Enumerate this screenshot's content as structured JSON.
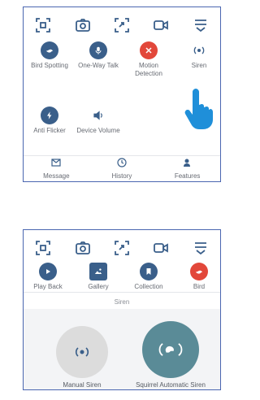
{
  "colors": {
    "icon": "#3a5f8a",
    "border": "#4a66b0",
    "red": "#e2473a",
    "teal": "#5a8b97",
    "gray": "#dcdcdc"
  },
  "toolbar_icons": [
    "fullscreen-icon",
    "camera-icon",
    "crop-icon",
    "video-icon",
    "menu-icon"
  ],
  "panel1": {
    "features": [
      {
        "label": "Bird Spotting",
        "icon": "bird-icon"
      },
      {
        "label": "One-Way Talk",
        "icon": "microphone-icon"
      },
      {
        "label": "Motion Detection",
        "icon": "motion-icon"
      },
      {
        "label": "Siren",
        "icon": "siren-icon"
      },
      {
        "label": "Anti Flicker",
        "icon": "flash-icon"
      },
      {
        "label": "Device Volume",
        "icon": "volume-icon"
      }
    ],
    "nav": [
      {
        "label": "Message",
        "icon": "mail-icon"
      },
      {
        "label": "History",
        "icon": "clock-icon"
      },
      {
        "label": "Features",
        "icon": "person-icon"
      }
    ]
  },
  "panel2": {
    "features": [
      {
        "label": "Play Back",
        "icon": "play-icon"
      },
      {
        "label": "Gallery",
        "icon": "image-icon"
      },
      {
        "label": "Collection",
        "icon": "bookmark-icon"
      },
      {
        "label": "Bird",
        "icon": "bird-icon"
      }
    ],
    "section_title": "Siren",
    "manual_siren": {
      "label": "Manual Siren"
    },
    "auto_siren": {
      "label": "Squirrel Automatic Siren"
    }
  }
}
